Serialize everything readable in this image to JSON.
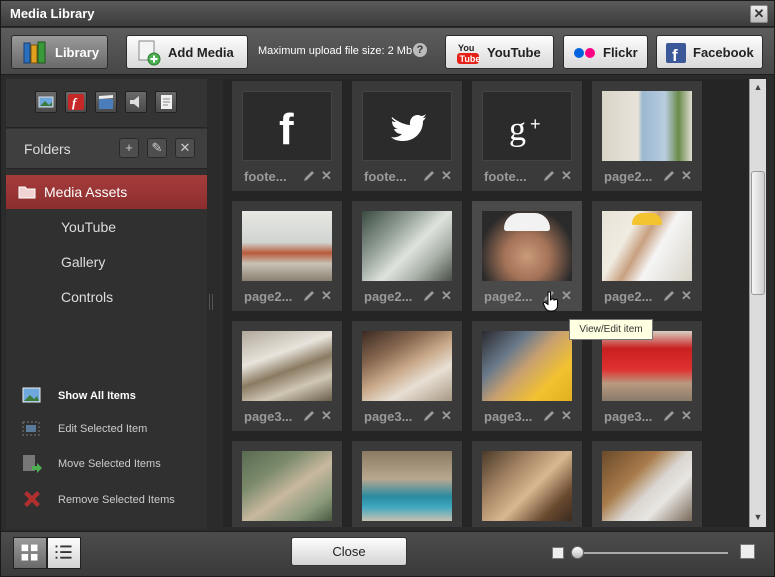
{
  "window": {
    "title": "Media Library",
    "close_glyph": "✕"
  },
  "toolbar": {
    "library_label": "Library",
    "add_media_label": "Add Media",
    "upload_info": "Maximum upload file size: 2 Mb",
    "help_glyph": "?",
    "youtube_label": "YouTube",
    "flickr_label": "Flickr",
    "facebook_label": "Facebook"
  },
  "sidebar": {
    "type_filters": [
      "image-icon",
      "flash-icon",
      "video-icon",
      "audio-icon",
      "document-icon"
    ],
    "folders_label": "Folders",
    "folder_buttons": [
      "+",
      "✎",
      "✕"
    ],
    "active_folder": "Media Assets",
    "subfolders": [
      "YouTube",
      "Gallery",
      "Controls"
    ],
    "actions": [
      {
        "label": "Show All Items",
        "icon": "show-all-icon"
      },
      {
        "label": "Edit Selected Item",
        "icon": "edit-selected-icon"
      },
      {
        "label": "Move Selected Items",
        "icon": "move-icon"
      },
      {
        "label": "Remove Selected Items",
        "icon": "remove-icon"
      }
    ]
  },
  "items": [
    {
      "name": "foote...",
      "thumb": "facebook-logo"
    },
    {
      "name": "foote...",
      "thumb": "twitter-logo"
    },
    {
      "name": "foote...",
      "thumb": "googleplus-logo"
    },
    {
      "name": "page2...",
      "thumb": "room-window-photo"
    },
    {
      "name": "page2...",
      "thumb": "kitchen-photo"
    },
    {
      "name": "page2...",
      "thumb": "bathroom-photo"
    },
    {
      "name": "page2...",
      "thumb": "worker-hardhat-photo"
    },
    {
      "name": "page2...",
      "thumb": "worker-tiling-photo"
    },
    {
      "name": "page3...",
      "thumb": "worker-kneeling-photo"
    },
    {
      "name": "page3...",
      "thumb": "drill-hands-photo"
    },
    {
      "name": "page3...",
      "thumb": "plumber-photo"
    },
    {
      "name": "page3...",
      "thumb": "worker-red-cap-photo"
    },
    {
      "name": "",
      "thumb": "drill-closeup-photo"
    },
    {
      "name": "",
      "thumb": "jigsaw-photo"
    },
    {
      "name": "",
      "thumb": "tools-table-photo"
    },
    {
      "name": "",
      "thumb": "saw-blade-photo"
    }
  ],
  "tooltip": "View/Edit item",
  "footer": {
    "close_label": "Close"
  },
  "colors": {
    "accent_red": "#8c2e2e",
    "tile_bg": "#3a3a3a",
    "facebook_blue": "#3b5998",
    "youtube_red": "#e62117",
    "flickr_blue": "#0063dc",
    "flickr_pink": "#ff0084"
  }
}
